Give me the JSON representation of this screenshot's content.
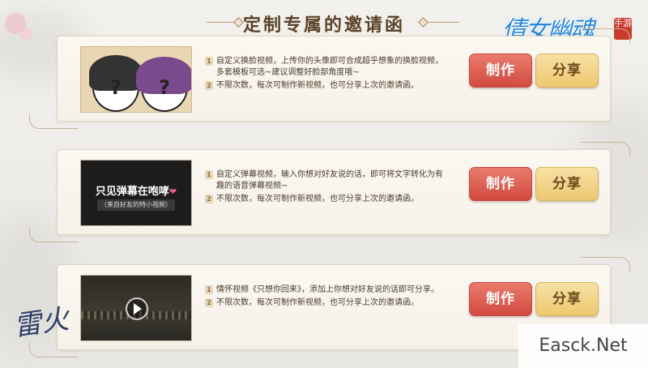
{
  "header": {
    "title": "定制专属的邀请函",
    "logo_text": "倩女幽魂",
    "logo_seal": "手游"
  },
  "cards": [
    {
      "thumb_caption": "",
      "items": [
        {
          "num": "1",
          "text": "自定义换脸视频，上传你的头像即可合成超乎想象的换脸视频，多套模板可选~建议调整好脸部角度哦~"
        },
        {
          "num": "2",
          "text": "不限次数，每次可制作新视频，也可分享上次的邀请函。"
        }
      ],
      "make_label": "制作",
      "share_label": "分享"
    },
    {
      "thumb_main": "只见弹幕在咆哮",
      "thumb_sub": "（来自好友的特小视频）",
      "items": [
        {
          "num": "1",
          "text": "自定义弹幕视频，输入你想对好友说的话，即可将文字转化为有趣的语音弹幕视频~"
        },
        {
          "num": "2",
          "text": "不限次数，每次可制作新视频，也可分享上次的邀请函。"
        }
      ],
      "make_label": "制作",
      "share_label": "分享"
    },
    {
      "items": [
        {
          "num": "1",
          "text": "情怀视频《只想你回来》，添加上你想对好友说的话即可分享。"
        },
        {
          "num": "2",
          "text": "不限次数，每次可制作新视频，也可分享上次的邀请函。"
        }
      ],
      "make_label": "制作",
      "share_label": "分享"
    }
  ],
  "corner_logo": "雷火",
  "watermark": "Easck.Net",
  "colors": {
    "make_button": "#d24a40",
    "share_button": "#edc86f",
    "title_text": "#5b4226",
    "logo_blue": "#2a86d6"
  }
}
